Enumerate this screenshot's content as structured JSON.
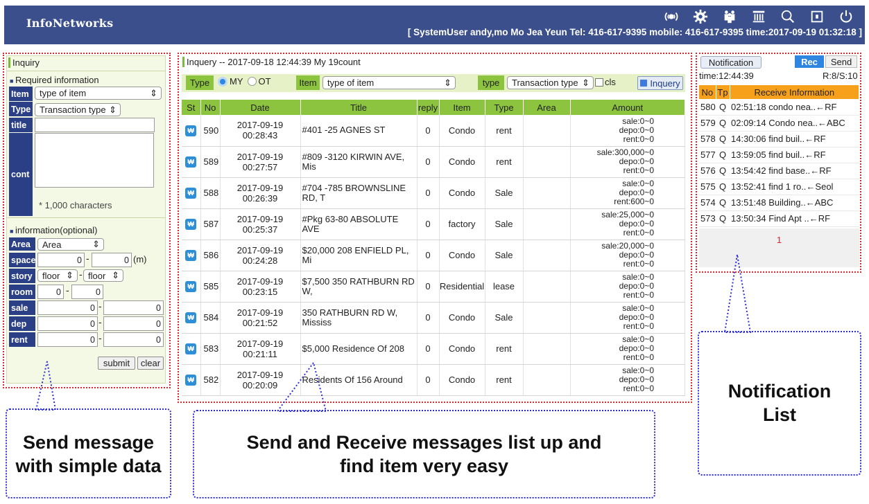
{
  "header": {
    "brand": "InfoNetworks",
    "user_info": "[ SystemUser  andy,mo  Mo Jea Yeun  Tel: 416-617-9395  mobile: 416-617-9395  time:2017-09-19 01:32:18 ]",
    "icons": [
      "broadcast-icon",
      "gear-icon",
      "users-icon",
      "bank-icon",
      "search-icon",
      "window-icon",
      "power-icon"
    ]
  },
  "inquiry": {
    "title": "Inquiry",
    "required_head": "Required information",
    "item_label": "Item",
    "item_value": "type of item",
    "type_label": "Type",
    "type_value": "Transaction type",
    "title_label": "title",
    "cont_label": "cont",
    "char_note": "* 1,000 characters",
    "optional_head": "information(optional)",
    "area_label": "Area",
    "area_value": "Area",
    "space_label": "space",
    "space_from": "0",
    "space_to": "0",
    "space_unit": "(m)",
    "story_label": "story",
    "story_from": "floor",
    "story_to": "floor",
    "room_label": "room",
    "room_from": "0",
    "room_to": "0",
    "sale_label": "sale",
    "sale_from": "0",
    "sale_to": "0",
    "dep_label": "dep",
    "dep_from": "0",
    "dep_to": "0",
    "rent_label": "rent",
    "rent_from": "0",
    "rent_to": "0",
    "submit": "submit",
    "clear": "clear",
    "dash": "-"
  },
  "list": {
    "title": "Inquery -- 2017-09-18 12:44:39 My 19count",
    "type_label": "Type",
    "radio_my": "MY",
    "radio_ot": "OT",
    "item_label": "Item",
    "item_value": "type of item",
    "type2_label": "type",
    "type2_value": "Transaction type",
    "cls_label": "cls",
    "search_button": "Inquery",
    "columns": [
      "St",
      "No",
      "Date",
      "Title",
      "reply",
      "Item",
      "Type",
      "Area",
      "Amount"
    ],
    "badge": "₩",
    "rows": [
      {
        "no": "590",
        "date": "2017-09-19\n00:28:43",
        "title": "#401 -25 AGNES ST",
        "reply": "0",
        "item": "Condo",
        "type": "rent",
        "area": "",
        "amount": "sale:0~0\ndepo:0~0\nrent:0~0"
      },
      {
        "no": "589",
        "date": "2017-09-19\n00:27:57",
        "title": "#809 -3120 KIRWIN AVE,\nMis",
        "reply": "0",
        "item": "Condo",
        "type": "rent",
        "area": "",
        "amount": "sale:300,000~0\ndepo:0~0\nrent:0~0"
      },
      {
        "no": "588",
        "date": "2017-09-19\n00:26:39",
        "title": "#704 -785 BROWNSLINE\nRD, T",
        "reply": "0",
        "item": "Condo",
        "type": "Sale",
        "area": "",
        "amount": "sale:0~0\ndepo:0~0\nrent:600~0"
      },
      {
        "no": "587",
        "date": "2017-09-19\n00:25:37",
        "title": "#Pkg 63-80 ABSOLUTE AVE",
        "reply": "0",
        "item": "factory",
        "type": "Sale",
        "area": "",
        "amount": "sale:25,000~0\ndepo:0~0\nrent:0~0"
      },
      {
        "no": "586",
        "date": "2017-09-19\n00:24:28",
        "title": "$20,000 208 ENFIELD PL,\nMi",
        "reply": "0",
        "item": "Condo",
        "type": "Sale",
        "area": "",
        "amount": "sale:20,000~0\ndepo:0~0\nrent:0~0"
      },
      {
        "no": "585",
        "date": "2017-09-19\n00:23:15",
        "title": "$7,500 350 RATHBURN RD\nW,",
        "reply": "0",
        "item": "Residential",
        "type": "lease",
        "area": "",
        "amount": "sale:0~0\ndepo:0~0\nrent:0~0"
      },
      {
        "no": "584",
        "date": "2017-09-19\n00:21:52",
        "title": "350 RATHBURN RD W,\nMississ",
        "reply": "0",
        "item": "Condo",
        "type": "Sale",
        "area": "",
        "amount": "sale:0~0\ndepo:0~0\nrent:0~0"
      },
      {
        "no": "583",
        "date": "2017-09-19\n00:21:11",
        "title": "$5,000 Residence Of 208",
        "reply": "0",
        "item": "Condo",
        "type": "rent",
        "area": "",
        "amount": "sale:0~0\ndepo:0~0\nrent:0~0"
      },
      {
        "no": "582",
        "date": "2017-09-19\n00:20:09",
        "title": "Residents Of 156 Around",
        "reply": "0",
        "item": "Condo",
        "type": "rent",
        "area": "",
        "amount": "sale:0~0\ndepo:0~0\nrent:0~0"
      }
    ]
  },
  "notification": {
    "tab_notification": "Notification",
    "tab_rec": "Rec",
    "tab_send": "Send",
    "time": "time:12:44:39",
    "counts": "R:8/S:10",
    "columns": [
      "No",
      "Tp",
      "Receive Information"
    ],
    "rows": [
      {
        "no": "580",
        "tp": "Q",
        "info": "02:51:18 condo nea..←RF"
      },
      {
        "no": "579",
        "tp": "Q",
        "info": "02:09:14 Condo nea..←ABC"
      },
      {
        "no": "578",
        "tp": "Q",
        "info": "14:30:06 find buil..←RF"
      },
      {
        "no": "577",
        "tp": "Q",
        "info": "13:59:05 find buil..←RF"
      },
      {
        "no": "576",
        "tp": "Q",
        "info": "13:54:42 find base..←RF"
      },
      {
        "no": "575",
        "tp": "Q",
        "info": "13:52:41 find 1 ro..←Seol"
      },
      {
        "no": "574",
        "tp": "Q",
        "info": "13:51:48 Building..←ABC"
      },
      {
        "no": "573",
        "tp": "Q",
        "info": "13:50:34 Find Apt ..←RF"
      }
    ],
    "page": "1"
  },
  "callouts": {
    "left": "Send message\nwith simple data",
    "middle": "Send and Receive messages list up and\nfind item very easy",
    "right": "Notification\nList"
  },
  "colors": {
    "header_bg": "#3a4f8c",
    "label_bg": "#2a3f86",
    "table_head": "#8cc43f",
    "notif_head": "#f7a01c",
    "red_dotted": "#d8262a",
    "blue_dotted": "#2b2bd8"
  }
}
